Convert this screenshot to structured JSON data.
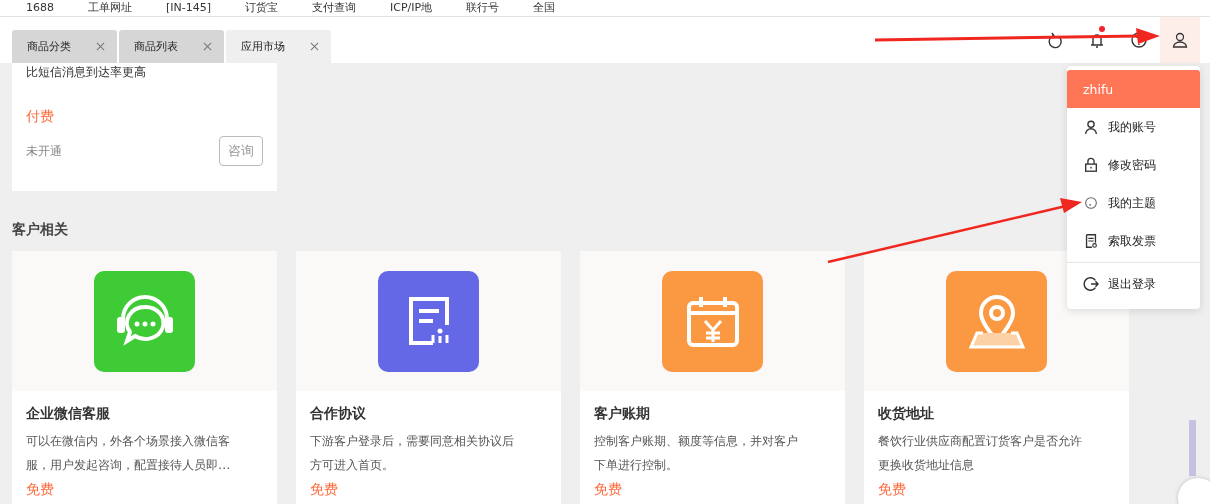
{
  "bookmarks": [
    "1688",
    "工单网址",
    "[IN-145]",
    "订货宝",
    "支付查询",
    "ICP/IP地",
    "联行号",
    "全国"
  ],
  "tabs": [
    {
      "label": "商品分类",
      "selected": false
    },
    {
      "label": "商品列表",
      "selected": false
    },
    {
      "label": "应用市场",
      "selected": true
    }
  ],
  "header": {
    "notification_dot": true
  },
  "partial_card": {
    "description": "比短信消息到达率更高",
    "price": "付费",
    "status": "未开通",
    "action": "咨询"
  },
  "section": {
    "title": "客户相关",
    "cards": [
      {
        "title": "企业微信客服",
        "description": [
          "可以在微信内，外各个场景接入微信客",
          "服，用户发起咨询，配置接待人员即…"
        ],
        "price": "免费",
        "kind": "chat",
        "color": "#3ecb36"
      },
      {
        "title": "合作协议",
        "description": [
          "下游客户登录后，需要同意相关协议后",
          "方可进入首页。"
        ],
        "price": "免费",
        "kind": "document",
        "color": "#6468e6"
      },
      {
        "title": "客户账期",
        "description": [
          "控制客户账期、额度等信息，并对客户",
          "下单进行控制。"
        ],
        "price": "免费",
        "kind": "calendar",
        "color": "#fb9842"
      },
      {
        "title": "收货地址",
        "description": [
          "餐饮行业供应商配置订货客户是否允许",
          "更换收货地址信息"
        ],
        "price": "免费",
        "kind": "location",
        "color": "#fb9842"
      }
    ]
  },
  "user_menu": {
    "username": "zhifu",
    "items": [
      {
        "label": "我的账号",
        "kind": "account"
      },
      {
        "label": "修改密码",
        "kind": "lock"
      },
      {
        "label": "我的主题",
        "kind": "theme"
      },
      {
        "label": "索取发票",
        "kind": "invoice"
      },
      {
        "label": "退出登录",
        "kind": "logout"
      }
    ]
  }
}
